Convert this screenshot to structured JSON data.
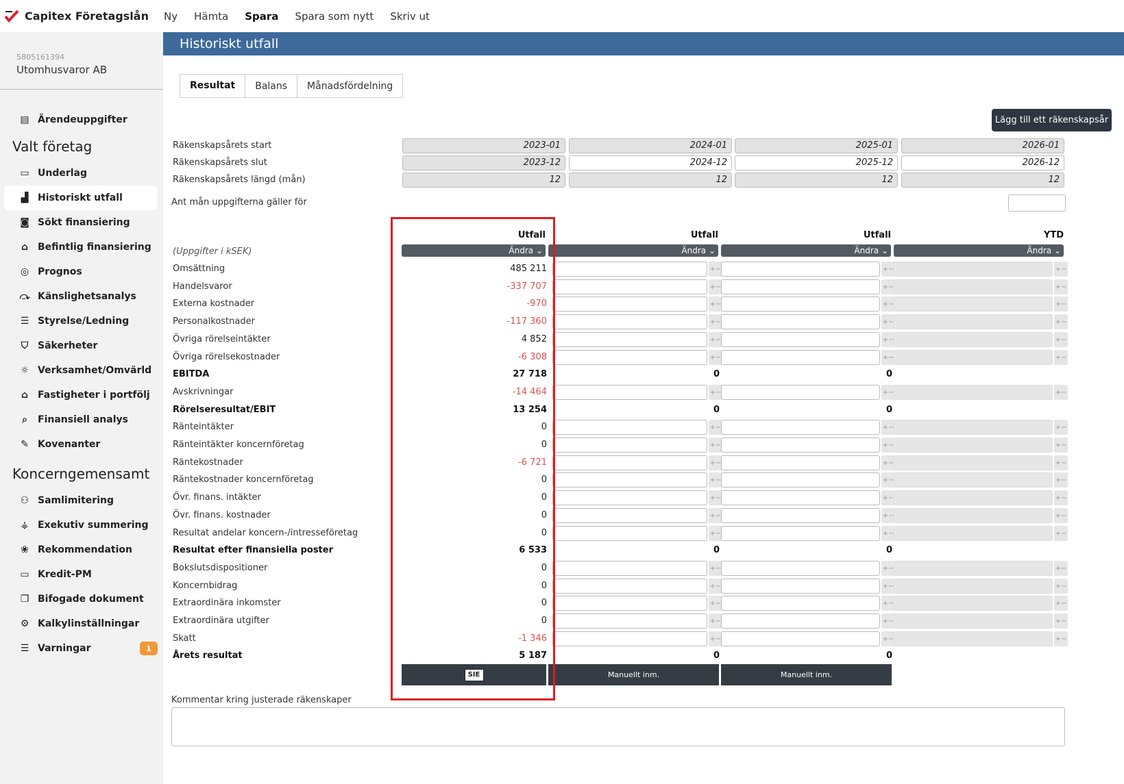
{
  "app": {
    "title": "Capitex Företagslån",
    "nav": [
      "Ny",
      "Hämta",
      "Spara",
      "Spara som nytt",
      "Skriv ut"
    ],
    "active_nav": "Spara"
  },
  "company": {
    "orgnr": "5805161394",
    "name": "Utomhusvaror AB"
  },
  "sidebar": {
    "top": [
      {
        "label": "Ärendeuppgifter",
        "icon": "id-card-icon"
      }
    ],
    "section1": "Valt företag",
    "group1": [
      {
        "label": "Underlag",
        "icon": "briefcase-icon"
      },
      {
        "label": "Historiskt utfall",
        "icon": "chart-icon",
        "active": true
      },
      {
        "label": "Sökt finansiering",
        "icon": "money-icon"
      },
      {
        "label": "Befintlig finansiering",
        "icon": "bank-icon"
      },
      {
        "label": "Prognos",
        "icon": "crystal-ball-icon"
      },
      {
        "label": "Känslighetsanalys",
        "icon": "sensitivity-icon"
      },
      {
        "label": "Styrelse/Ledning",
        "icon": "board-icon"
      },
      {
        "label": "Säkerheter",
        "icon": "shield-icon"
      },
      {
        "label": "Verksamhet/Omvärld",
        "icon": "sun-icon"
      },
      {
        "label": "Fastigheter i portfölj",
        "icon": "house-icon"
      },
      {
        "label": "Finansiell analys",
        "icon": "magnifier-dollar-icon"
      },
      {
        "label": "Kovenanter",
        "icon": "contract-icon"
      }
    ],
    "section2": "Koncerngemensamt",
    "group2": [
      {
        "label": "Samlimitering",
        "icon": "group-icon"
      },
      {
        "label": "Exekutiv summering",
        "icon": "hierarchy-icon"
      },
      {
        "label": "Rekommendation",
        "icon": "brain-icon"
      },
      {
        "label": "Kredit-PM",
        "icon": "credit-card-icon"
      },
      {
        "label": "Bifogade dokument",
        "icon": "documents-icon"
      },
      {
        "label": "Kalkylinställningar",
        "icon": "gear-icon"
      },
      {
        "label": "Varningar",
        "icon": "warning-message-icon",
        "badge": "1"
      }
    ]
  },
  "page": {
    "title": "Historiskt utfall",
    "tabs": [
      "Resultat",
      "Balans",
      "Månadsfördelning"
    ],
    "add_button": "Lägg till ett räkenskapsår"
  },
  "periods": {
    "labels": [
      "Räkenskapsårets start",
      "Räkenskapsårets slut",
      "Räkenskapsårets längd (mån)",
      "Ant mån uppgifterna gäller för"
    ],
    "start": [
      "2023-01",
      "2024-01",
      "2025-01",
      "2026-01"
    ],
    "end": [
      "2023-12",
      "2024-12",
      "2025-12",
      "2026-12"
    ],
    "length": [
      "12",
      "12",
      "12",
      "12"
    ]
  },
  "table": {
    "unit_label": "(Uppgifter i kSEK)",
    "col_heads": [
      "Utfall",
      "Utfall",
      "Utfall",
      "YTD"
    ],
    "andra": "Ändra",
    "rows": [
      {
        "label": "Omsättning",
        "v": "485 211"
      },
      {
        "label": "Handelsvaror",
        "v": "-337 707",
        "neg": true
      },
      {
        "label": "Externa kostnader",
        "v": "-970",
        "neg": true
      },
      {
        "label": "Personalkostnader",
        "v": "-117 360",
        "neg": true
      },
      {
        "label": "Övriga rörelseintäkter",
        "v": "4 852"
      },
      {
        "label": "Övriga rörelsekostnader",
        "v": "-6 308",
        "neg": true
      },
      {
        "label": "EBITDA",
        "v": "27 718",
        "bold": true,
        "c2": "0",
        "c3": "0"
      },
      {
        "label": "Avskrivningar",
        "v": "-14 464",
        "neg": true
      },
      {
        "label": "Rörelseresultat/EBIT",
        "v": "13 254",
        "bold": true,
        "c2": "0",
        "c3": "0"
      },
      {
        "label": "Ränteintäkter",
        "v": "0"
      },
      {
        "label": "Ränteintäkter koncernföretag",
        "v": "0"
      },
      {
        "label": "Räntekostnader",
        "v": "-6 721",
        "neg": true
      },
      {
        "label": "Räntekostnader koncernföretag",
        "v": "0"
      },
      {
        "label": "Övr. finans. intäkter",
        "v": "0"
      },
      {
        "label": "Övr. finans. kostnader",
        "v": "0"
      },
      {
        "label": "Resultat andelar koncern-/intresseföretag",
        "v": "0"
      },
      {
        "label": "Resultat efter finansiella poster",
        "v": "6 533",
        "bold": true,
        "c2": "0",
        "c3": "0"
      },
      {
        "label": "Bokslutsdispositioner",
        "v": "0"
      },
      {
        "label": "Koncernbidrag",
        "v": "0"
      },
      {
        "label": "Extraordinära inkomster",
        "v": "0"
      },
      {
        "label": "Extraordinära utgifter",
        "v": "0"
      },
      {
        "label": "Skatt",
        "v": "-1 346",
        "neg": true
      },
      {
        "label": "Årets resultat",
        "v": "5 187",
        "bold": true,
        "c2": "0",
        "c3": "0"
      }
    ],
    "footer": [
      "SIE",
      "Manuellt inm.",
      "Manuellt inm."
    ]
  },
  "comment": {
    "label": "Kommentar kring justerade räkenskaper"
  }
}
